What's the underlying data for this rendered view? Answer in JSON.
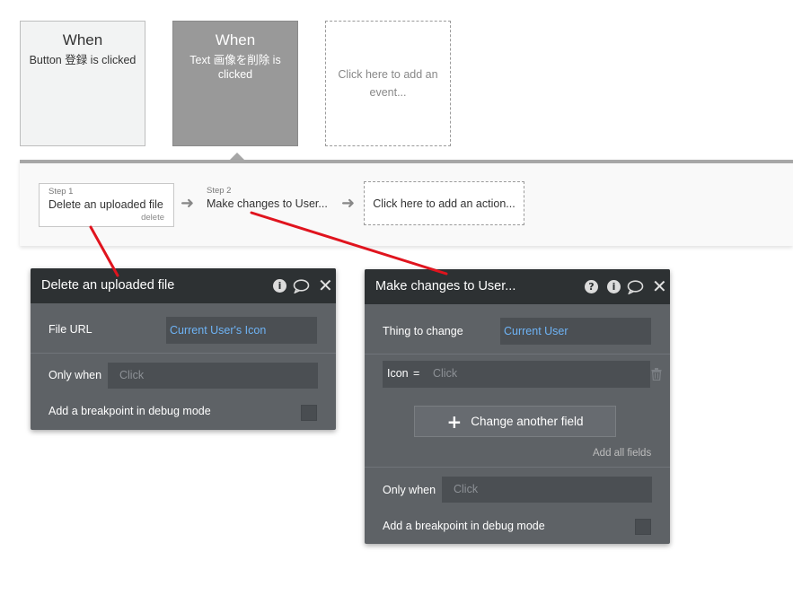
{
  "events": [
    {
      "when": "When",
      "description": "Button 登録 is clicked"
    },
    {
      "when": "When",
      "description": "Text 画像を削除 is clicked"
    },
    {
      "placeholder": "Click here to add an event..."
    }
  ],
  "workflow": {
    "steps": [
      {
        "number": "Step 1",
        "title": "Delete an uploaded file",
        "delete_label": "delete"
      },
      {
        "number": "Step 2",
        "title": "Make changes to User..."
      }
    ],
    "add_action": "Click here to add an action..."
  },
  "panel_delete": {
    "title": "Delete an uploaded file",
    "file_url_label": "File URL",
    "file_url_value": "Current User's Icon",
    "only_when_label": "Only when",
    "only_when_placeholder": "Click",
    "breakpoint_label": "Add a breakpoint in debug mode"
  },
  "panel_change": {
    "title": "Make changes to User...",
    "thing_label": "Thing to change",
    "thing_value": "Current User",
    "field_name": "Icon",
    "field_op": "=",
    "field_placeholder": "Click",
    "change_button": "Change another field",
    "add_all_fields": "Add all fields",
    "only_when_label": "Only when",
    "only_when_placeholder": "Click",
    "breakpoint_label": "Add a breakpoint in debug mode"
  },
  "icons": {
    "help": "help-icon",
    "info": "info-icon",
    "comment": "comment-icon",
    "close": "close-icon",
    "trash": "trash-icon",
    "arrow": "arrow-right-icon",
    "plus": "plus-icon"
  },
  "colors": {
    "panel_bg": "#5e6266",
    "panel_header": "#2d3133",
    "dynamic_text": "#6eb3f5",
    "annotation_red": "#e0141e",
    "selected_event": "#999999"
  }
}
